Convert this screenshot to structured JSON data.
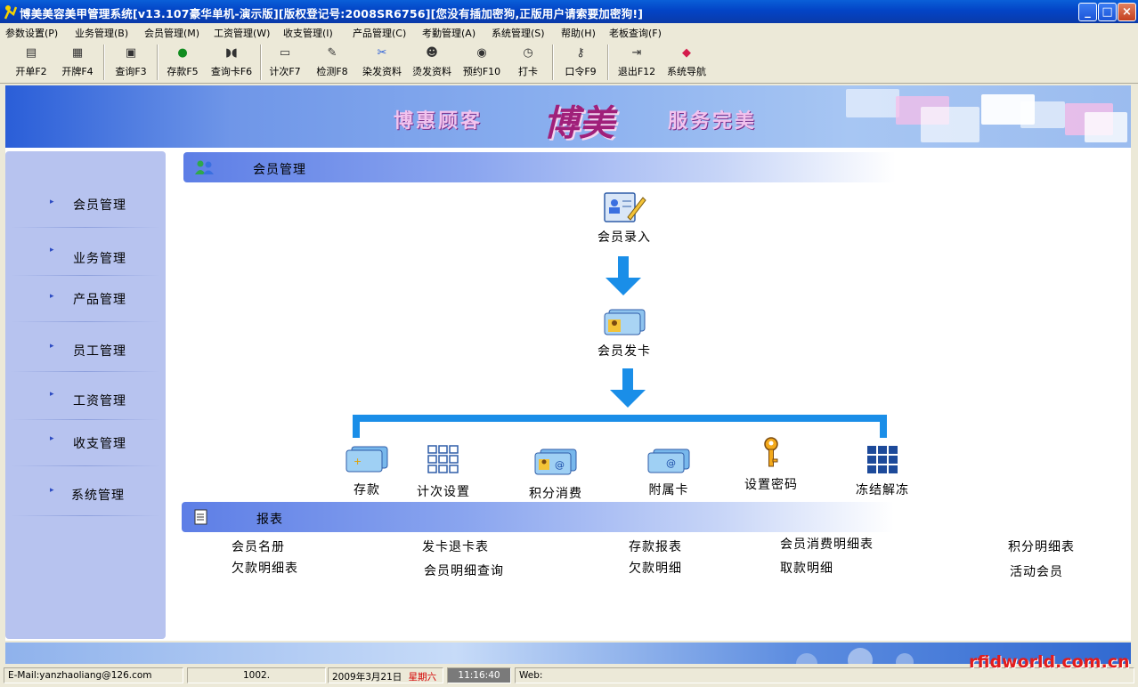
{
  "window": {
    "title": "博美美容美甲管理系统[v13.107豪华单机-演示版][版权登记号:2008SR6756][您没有插加密狗,正版用户请索要加密狗!]",
    "controls": [
      "_",
      "□",
      "×"
    ]
  },
  "menu": [
    "参数设置(P)",
    "业务管理(B)",
    "会员管理(M)",
    "工资管理(W)",
    "收支管理(I)",
    "产品管理(C)",
    "考勤管理(A)",
    "系统管理(S)",
    "帮助(H)",
    "老板查询(F)"
  ],
  "toolbar": [
    {
      "label": "开单F2",
      "icon": "bill-icon"
    },
    {
      "label": "开牌F4",
      "icon": "grid-icon"
    },
    {
      "label": "查询F3",
      "icon": "query-icon"
    },
    {
      "label": "存款F5",
      "icon": "money-bag-icon"
    },
    {
      "label": "查询卡F6",
      "icon": "binoculars-icon"
    },
    {
      "label": "计次F7",
      "icon": "counter-icon"
    },
    {
      "label": "检测F8",
      "icon": "probe-icon"
    },
    {
      "label": "染发资料",
      "icon": "dye-icon"
    },
    {
      "label": "烫发资料",
      "icon": "perm-icon"
    },
    {
      "label": "预约F10",
      "icon": "appointment-icon"
    },
    {
      "label": "打卡",
      "icon": "clock-icon"
    },
    {
      "label": "口令F9",
      "icon": "key-icon"
    },
    {
      "label": "退出F12",
      "icon": "exit-icon"
    },
    {
      "label": "系统导航",
      "icon": "nav-icon"
    }
  ],
  "banner": {
    "left": "博惠顾客",
    "center": "博美",
    "right": "服务完美"
  },
  "sidebar": [
    "会员管理",
    "业务管理",
    "产品管理",
    "员工管理",
    "工资管理",
    "收支管理",
    "系统管理"
  ],
  "section_member": {
    "title": "会员管理",
    "entry": "会员录入",
    "issue": "会员发卡",
    "actions": [
      "存款",
      "计次设置",
      "积分消费",
      "附属卡",
      "设置密码",
      "冻结解冻"
    ]
  },
  "section_report": {
    "title": "报表",
    "items": [
      "会员名册",
      "欠款明细表",
      "发卡退卡表",
      "会员明细查询",
      "存款报表",
      "欠款明细",
      "会员消费明细表",
      "取款明细",
      "积分明细表",
      "活动会员"
    ]
  },
  "status": {
    "email": "E-Mail:yanzhaoliang@126.com",
    "code": "1002.",
    "date": "2009年3月21日",
    "weekday": "星期六",
    "time": "11:16:40",
    "web": "Web:"
  },
  "watermark": "rfidworld.com.cn"
}
